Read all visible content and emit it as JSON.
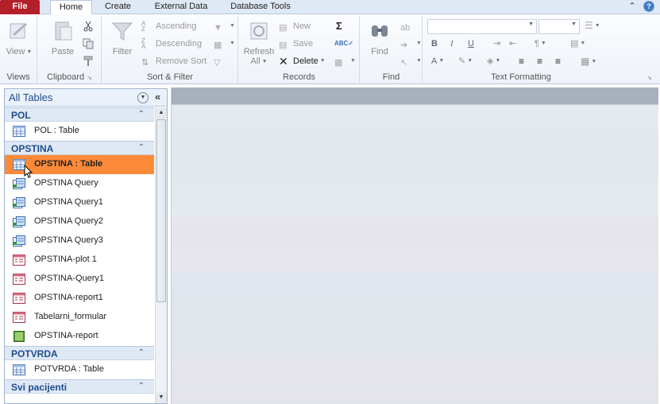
{
  "tabs": {
    "file": "File",
    "home": "Home",
    "create": "Create",
    "external": "External Data",
    "dbtools": "Database Tools"
  },
  "ribbon": {
    "views": {
      "view": "View",
      "label": "Views"
    },
    "clipboard": {
      "paste": "Paste",
      "label": "Clipboard"
    },
    "sortfilter": {
      "filter": "Filter",
      "ascending": "Ascending",
      "descending": "Descending",
      "remove_sort": "Remove Sort",
      "label": "Sort & Filter"
    },
    "records": {
      "refresh": "Refresh",
      "refresh2": "All",
      "new": "New",
      "save": "Save",
      "delete": "Delete",
      "label": "Records"
    },
    "find": {
      "find": "Find",
      "label": "Find"
    },
    "textfmt": {
      "label": "Text Formatting",
      "bold": "B",
      "italic": "I",
      "underline": "U",
      "fontcolor": "A"
    }
  },
  "nav": {
    "header": "All Tables",
    "groups": [
      {
        "name": "POL",
        "items": [
          "POL : Table"
        ]
      },
      {
        "name": "OPSTINA",
        "items": [
          "OPSTINA : Table",
          "OPSTINA Query",
          "OPSTINA Query1",
          "OPSTINA Query2",
          "OPSTINA Query3",
          "OPSTINA-plot 1",
          "OPSTINA-Query1",
          "OPSTINA-report1",
          "Tabelarni_formular",
          "OPSTINA-report"
        ]
      },
      {
        "name": "POTVRDA",
        "items": [
          "POTVRDA : Table"
        ]
      },
      {
        "name": "Svi pacijenti",
        "items": []
      }
    ]
  },
  "colors": {
    "file_tab": "#b3202a",
    "selected_item": "#fd8a39",
    "group_header": "#dfe8f5",
    "accent": "#1f4e8c"
  }
}
